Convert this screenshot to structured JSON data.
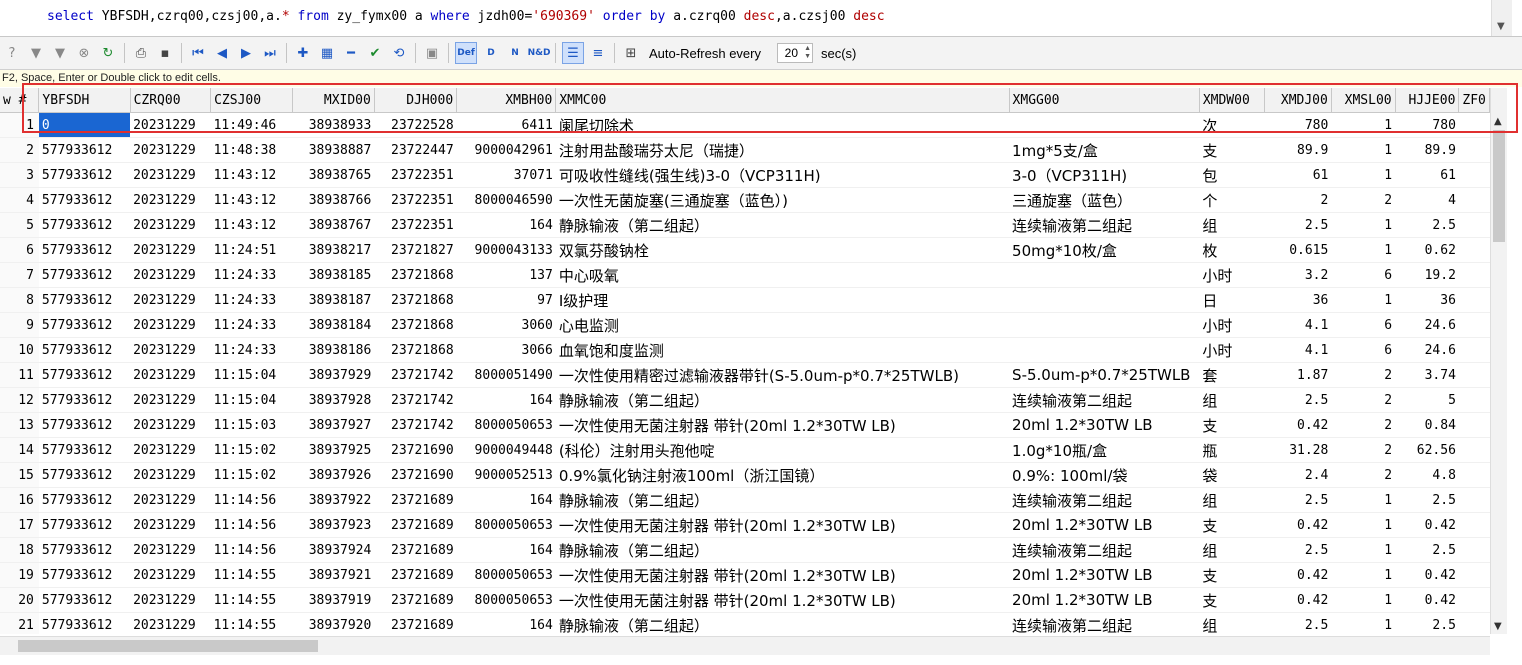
{
  "sql": {
    "line": "select YBFSDH,czrq00,czsj00,a.* from zy_fymx00 a where jzdh00='690369' order by a.czrq00 desc,a.czsj00 desc"
  },
  "toolbar": {
    "auto_refresh_label": "Auto-Refresh every",
    "interval_value": "20",
    "sec_label": "sec(s)",
    "def_label": "Def",
    "d_label": "D",
    "n_label": "N",
    "nd_label": "N&D"
  },
  "hint": {
    "text": "F2, Space, Enter or Double click to edit cells."
  },
  "grid": {
    "columns": [
      "w #",
      "YBFSDH",
      "CZRQ00",
      "CZSJ00",
      "MXID00",
      "DJH000",
      "XMBH00",
      "XMMC00",
      "XMGG00",
      "XMDW00",
      "XMDJ00",
      "XMSL00",
      "HJJE00",
      "ZF0"
    ],
    "rows": [
      [
        "1",
        "0",
        "20231229",
        "11:49:46",
        "38938933",
        "23722528",
        "6411",
        "阑尾切除术",
        "",
        "次",
        "780",
        "1",
        "780"
      ],
      [
        "2",
        "577933612",
        "20231229",
        "11:48:38",
        "38938887",
        "23722447",
        "9000042961",
        "注射用盐酸瑞芬太尼（瑞捷）",
        "1mg*5支/盒",
        "支",
        "89.9",
        "1",
        "89.9"
      ],
      [
        "3",
        "577933612",
        "20231229",
        "11:43:12",
        "38938765",
        "23722351",
        "37071",
        "可吸收性缝线(强生线)3-0（VCP311H)",
        "3-0（VCP311H)",
        "包",
        "61",
        "1",
        "61"
      ],
      [
        "4",
        "577933612",
        "20231229",
        "11:43:12",
        "38938766",
        "23722351",
        "8000046590",
        "一次性无菌旋塞(三通旋塞（蓝色）)",
        "三通旋塞（蓝色）",
        "个",
        "2",
        "2",
        "4"
      ],
      [
        "5",
        "577933612",
        "20231229",
        "11:43:12",
        "38938767",
        "23722351",
        "164",
        "静脉输液（第二组起）",
        "连续输液第二组起",
        "组",
        "2.5",
        "1",
        "2.5"
      ],
      [
        "6",
        "577933612",
        "20231229",
        "11:24:51",
        "38938217",
        "23721827",
        "9000043133",
        "双氯芬酸钠栓",
        "50mg*10枚/盒",
        "枚",
        "0.615",
        "1",
        "0.62"
      ],
      [
        "7",
        "577933612",
        "20231229",
        "11:24:33",
        "38938185",
        "23721868",
        "137",
        "中心吸氧",
        "",
        "小时",
        "3.2",
        "6",
        "19.2"
      ],
      [
        "8",
        "577933612",
        "20231229",
        "11:24:33",
        "38938187",
        "23721868",
        "97",
        "I级护理",
        "",
        "日",
        "36",
        "1",
        "36"
      ],
      [
        "9",
        "577933612",
        "20231229",
        "11:24:33",
        "38938184",
        "23721868",
        "3060",
        "心电监测",
        "",
        "小时",
        "4.1",
        "6",
        "24.6"
      ],
      [
        "10",
        "577933612",
        "20231229",
        "11:24:33",
        "38938186",
        "23721868",
        "3066",
        "血氧饱和度监测",
        "",
        "小时",
        "4.1",
        "6",
        "24.6"
      ],
      [
        "11",
        "577933612",
        "20231229",
        "11:15:04",
        "38937929",
        "23721742",
        "8000051490",
        "一次性使用精密过滤输液器带针(S-5.0um-p*0.7*25TWLB)",
        "S-5.0um-p*0.7*25TWLB",
        "套",
        "1.87",
        "2",
        "3.74"
      ],
      [
        "12",
        "577933612",
        "20231229",
        "11:15:04",
        "38937928",
        "23721742",
        "164",
        "静脉输液（第二组起）",
        "连续输液第二组起",
        "组",
        "2.5",
        "2",
        "5"
      ],
      [
        "13",
        "577933612",
        "20231229",
        "11:15:03",
        "38937927",
        "23721742",
        "8000050653",
        "一次性使用无菌注射器 带针(20ml 1.2*30TW LB)",
        "20ml 1.2*30TW LB",
        "支",
        "0.42",
        "2",
        "0.84"
      ],
      [
        "14",
        "577933612",
        "20231229",
        "11:15:02",
        "38937925",
        "23721690",
        "9000049448",
        "(科伦）注射用头孢他啶",
        "1.0g*10瓶/盒",
        "瓶",
        "31.28",
        "2",
        "62.56"
      ],
      [
        "15",
        "577933612",
        "20231229",
        "11:15:02",
        "38937926",
        "23721690",
        "9000052513",
        "0.9%氯化钠注射液100ml（浙江国镜）",
        "0.9%: 100ml/袋",
        "袋",
        "2.4",
        "2",
        "4.8"
      ],
      [
        "16",
        "577933612",
        "20231229",
        "11:14:56",
        "38937922",
        "23721689",
        "164",
        "静脉输液（第二组起）",
        "连续输液第二组起",
        "组",
        "2.5",
        "1",
        "2.5"
      ],
      [
        "17",
        "577933612",
        "20231229",
        "11:14:56",
        "38937923",
        "23721689",
        "8000050653",
        "一次性使用无菌注射器 带针(20ml 1.2*30TW LB)",
        "20ml 1.2*30TW LB",
        "支",
        "0.42",
        "1",
        "0.42"
      ],
      [
        "18",
        "577933612",
        "20231229",
        "11:14:56",
        "38937924",
        "23721689",
        "164",
        "静脉输液（第二组起）",
        "连续输液第二组起",
        "组",
        "2.5",
        "1",
        "2.5"
      ],
      [
        "19",
        "577933612",
        "20231229",
        "11:14:55",
        "38937921",
        "23721689",
        "8000050653",
        "一次性使用无菌注射器 带针(20ml 1.2*30TW LB)",
        "20ml 1.2*30TW LB",
        "支",
        "0.42",
        "1",
        "0.42"
      ],
      [
        "20",
        "577933612",
        "20231229",
        "11:14:55",
        "38937919",
        "23721689",
        "8000050653",
        "一次性使用无菌注射器 带针(20ml 1.2*30TW LB)",
        "20ml 1.2*30TW LB",
        "支",
        "0.42",
        "1",
        "0.42"
      ],
      [
        "21",
        "577933612",
        "20231229",
        "11:14:55",
        "38937920",
        "23721689",
        "164",
        "静脉输液（第二组起）",
        "连续输液第二组起",
        "组",
        "2.5",
        "1",
        "2.5"
      ]
    ]
  }
}
